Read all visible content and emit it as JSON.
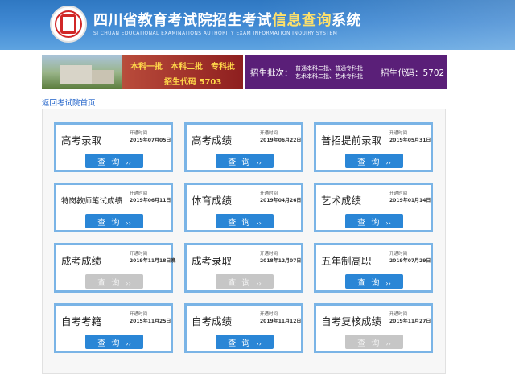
{
  "header": {
    "title_plain": "四川省教育考试院招生考试",
    "title_highlight": "信息查询",
    "title_tail": "系统",
    "subtitle": "SI CHUAN EDUCATIONAL EXAMINATIONS AUTHORITY EXAM INFORMATION INQUIRY SYSTEM"
  },
  "banner": {
    "left_line1": "本科一批　本科二批　专科批",
    "left_line2": "招生代码 5703",
    "right_label": "招生批次：",
    "right_batches_line1": "普通本科二批、普通专科批",
    "right_batches_line2": "艺术本科二批、艺术专科批",
    "right_code": "招生代码：5702"
  },
  "back_link": "返回考试院首页",
  "query_label": "查 询",
  "query_arrow": "››",
  "cards": [
    {
      "title": "高考录取",
      "open_label": "开通时间",
      "date": "2019年07月05日"
    },
    {
      "title": "高考成绩",
      "open_label": "开通时间",
      "date": "2019年06月22日"
    },
    {
      "title": "普招提前录取",
      "open_label": "开通时间",
      "date": "2019年05月31日"
    },
    {
      "title": "特岗教师笔试成绩",
      "open_label": "开通时间",
      "date": "2019年06月11日"
    },
    {
      "title": "体育成绩",
      "open_label": "开通时间",
      "date": "2019年04月26日"
    },
    {
      "title": "艺术成绩",
      "open_label": "开通时间",
      "date": "2019年01月14日"
    },
    {
      "title": "成考成绩",
      "open_label": "开通时间",
      "date": "2019年11月18日晚"
    },
    {
      "title": "成考录取",
      "open_label": "开通时间",
      "date": "2018年12月07日"
    },
    {
      "title": "五年制高职",
      "open_label": "开通时间",
      "date": "2019年07月29日"
    },
    {
      "title": "自考考籍",
      "open_label": "开通时间",
      "date": "2015年11月25日"
    },
    {
      "title": "自考成绩",
      "open_label": "开通时间",
      "date": "2019年11月12日"
    },
    {
      "title": "自考复核成绩",
      "open_label": "开通时间",
      "date": "2019年11月27日"
    }
  ],
  "colors": {
    "header_blue": "#3f88d2",
    "card_border": "#7ab4e6",
    "button_active": "#2a86d6",
    "button_disabled": "#c6c6c6",
    "banner_purple": "#5a1f78",
    "highlight_yellow": "#ffe16a"
  }
}
